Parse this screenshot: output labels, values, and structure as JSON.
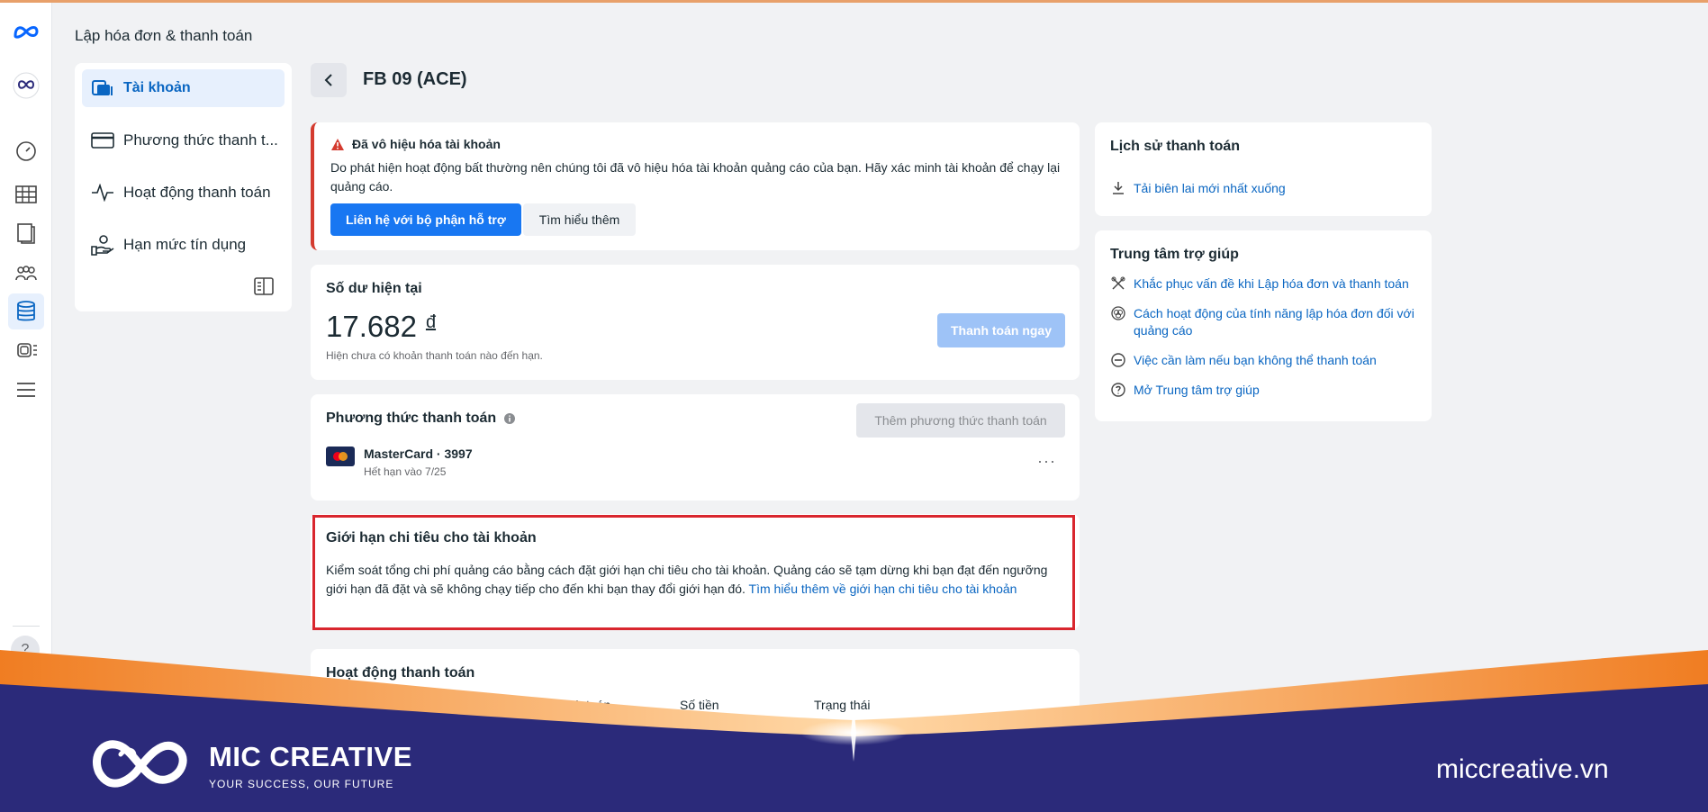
{
  "header": {
    "title": "Lập hóa đơn & thanh toán"
  },
  "rail": {
    "icons": [
      "meta-logo-icon",
      "account-avatar-icon",
      "dashboard-gauge-icon",
      "table-icon",
      "pages-icon",
      "audience-icon",
      "billing-icon",
      "ads-icon",
      "menu-icon",
      "help-icon"
    ],
    "help_glyph": "?"
  },
  "nav": {
    "items": [
      {
        "label": "Tài khoản",
        "icon": "account-icon",
        "active": true
      },
      {
        "label": "Phương thức thanh t...",
        "icon": "credit-card-icon",
        "active": false
      },
      {
        "label": "Hoạt động thanh toán",
        "icon": "activity-pulse-icon",
        "active": false
      },
      {
        "label": "Hạn mức tín dụng",
        "icon": "credit-limit-icon",
        "active": false
      }
    ]
  },
  "page": {
    "title": "FB 09 (ACE)"
  },
  "alert": {
    "title": "Đã vô hiệu hóa tài khoản",
    "body": "Do phát hiện hoạt động bất thường nên chúng tôi đã vô hiệu hóa tài khoản quảng cáo của bạn. Hãy xác minh tài khoản để chạy lại quảng cáo.",
    "primary_button": "Liên hệ với bộ phận hỗ trợ",
    "secondary_button": "Tìm hiểu thêm",
    "accent": "#d43b2f"
  },
  "balance": {
    "title": "Số dư hiện tại",
    "amount": "17.682",
    "currency": "đ",
    "note": "Hiện chưa có khoản thanh toán nào đến hạn.",
    "pay_button": "Thanh toán ngay"
  },
  "payment_methods": {
    "title": "Phương thức thanh toán",
    "add_button": "Thêm phương thức thanh toán",
    "card_name": "MasterCard · 3997",
    "card_expiry": "Hết hạn vào 7/25",
    "more": "···"
  },
  "spending_limit": {
    "title": "Giới hạn chi tiêu cho tài khoản",
    "body": "Kiểm soát tổng chi phí quảng cáo bằng cách đặt giới hạn chi tiêu cho tài khoản. Quảng cáo sẽ tạm dừng khi bạn đạt đến ngưỡng giới hạn đã đặt và sẽ không chạy tiếp cho đến khi bạn thay đổi giới hạn đó.",
    "link": "Tìm hiểu thêm về giới hạn chi tiêu cho tài khoản"
  },
  "activity": {
    "title": "Hoạt động thanh toán",
    "columns": [
      "Phương thức thanh toán",
      "Số tiền",
      "Trạng thái"
    ]
  },
  "history": {
    "title": "Lịch sử thanh toán",
    "download_link": "Tải biên lai mới nhất xuống"
  },
  "help_center": {
    "title": "Trung tâm trợ giúp",
    "links": [
      {
        "label": "Khắc phục vấn đề khi Lập hóa đơn và thanh toán",
        "icon": "tools-icon"
      },
      {
        "label": "Cách hoạt động của tính năng lập hóa đơn đối với quảng cáo",
        "icon": "gear-cluster-icon"
      },
      {
        "label": "Việc cần làm nếu bạn không thể thanh toán",
        "icon": "minus-circle-icon"
      },
      {
        "label": "Mở Trung tâm trợ giúp",
        "icon": "question-circle-icon"
      }
    ]
  },
  "brand": {
    "name": "MIC CREATIVE",
    "tagline": "YOUR SUCCESS, OUR FUTURE",
    "url": "miccreative.vn",
    "colors": {
      "navy": "#2b2a7a",
      "orange": "#f0892a"
    }
  }
}
